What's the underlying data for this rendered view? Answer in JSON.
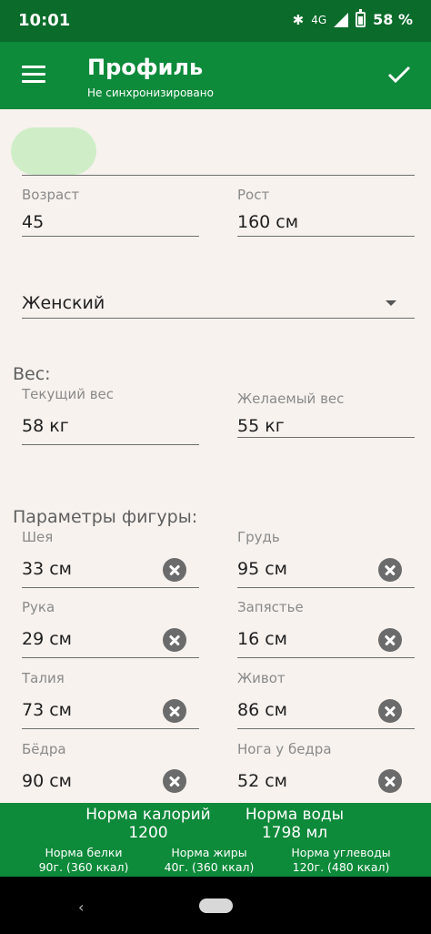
{
  "status_bar": {
    "time": "10:01",
    "bluetooth_icon": "bluetooth-icon",
    "network": "4G",
    "battery_percent": "58 %"
  },
  "app_bar": {
    "title": "Профиль",
    "subtitle": "Не синхронизировано",
    "menu_icon": "menu-icon",
    "confirm_icon": "check-icon"
  },
  "profile": {
    "age_label": "Возраст",
    "age_value": "45",
    "height_label": "Рост",
    "height_value": "160 см",
    "gender_value": "Женский"
  },
  "weight": {
    "section_title": "Вес:",
    "current_label": "Текущий вес",
    "current_value": "58 кг",
    "desired_label": "Желаемый вес",
    "desired_value": "55 кг"
  },
  "body_params": {
    "section_title": "Параметры фигуры:",
    "fields": [
      {
        "label": "Шея",
        "value": "33 см"
      },
      {
        "label": "Грудь",
        "value": "95 см"
      },
      {
        "label": "Рука",
        "value": "29 см"
      },
      {
        "label": "Запястье",
        "value": "16 см"
      },
      {
        "label": "Талия",
        "value": "73 см"
      },
      {
        "label": "Живот",
        "value": "86 см"
      },
      {
        "label": "Бёдра",
        "value": "90 см"
      },
      {
        "label": "Нога у бедра",
        "value": "52 см"
      }
    ]
  },
  "summary": {
    "calories_label": "Норма калорий",
    "calories_value": "1200",
    "water_label": "Норма воды",
    "water_value": "1798 мл",
    "protein_label": "Норма белки",
    "protein_value": "90г. (360 ккал)",
    "fat_label": "Норма жиры",
    "fat_value": "40г. (360 ккал)",
    "carbs_label": "Норма углеводы",
    "carbs_value": "120г. (480 ккал)"
  },
  "nav": {
    "back_icon": "back-chevron-icon",
    "home_icon": "home-pill-icon"
  },
  "colors": {
    "status_bar": "#0a6b2a",
    "app_bar": "#0d8a3a",
    "background": "#f7f2ee"
  }
}
